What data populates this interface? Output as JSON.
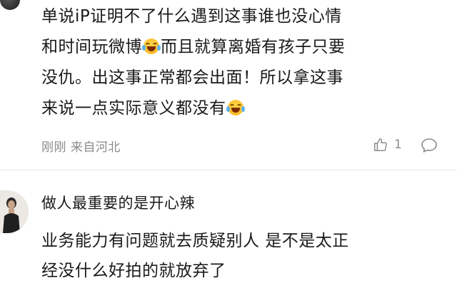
{
  "comment1": {
    "text_line1": "单说iP证明不了什么遇到这事谁也没心情",
    "text_line2_a": "和时间玩微博",
    "text_line2_b": "而且就算离婚有孩子只要",
    "text_line3": "没仇。出这事正常都会出面！所以拿这事",
    "text_line4": "来说一点实际意义都没有",
    "emoji": "laughing-tears-emoji",
    "meta": "刚刚 来自河北",
    "like_count": "1",
    "icons": {
      "like": "thumbs-up-icon",
      "reply": "comment-bubble-icon"
    }
  },
  "comment2": {
    "username": "做人最重要的是开心辣",
    "text_line1": "业务能力有问题就去质疑别人 是不是太正",
    "text_line2": "经没什么好拍的就放弃了"
  },
  "colors": {
    "text_primary": "#1a1a1a",
    "text_meta": "#8c8c8c",
    "divider": "#e8e8e8",
    "background": "#ffffff"
  }
}
